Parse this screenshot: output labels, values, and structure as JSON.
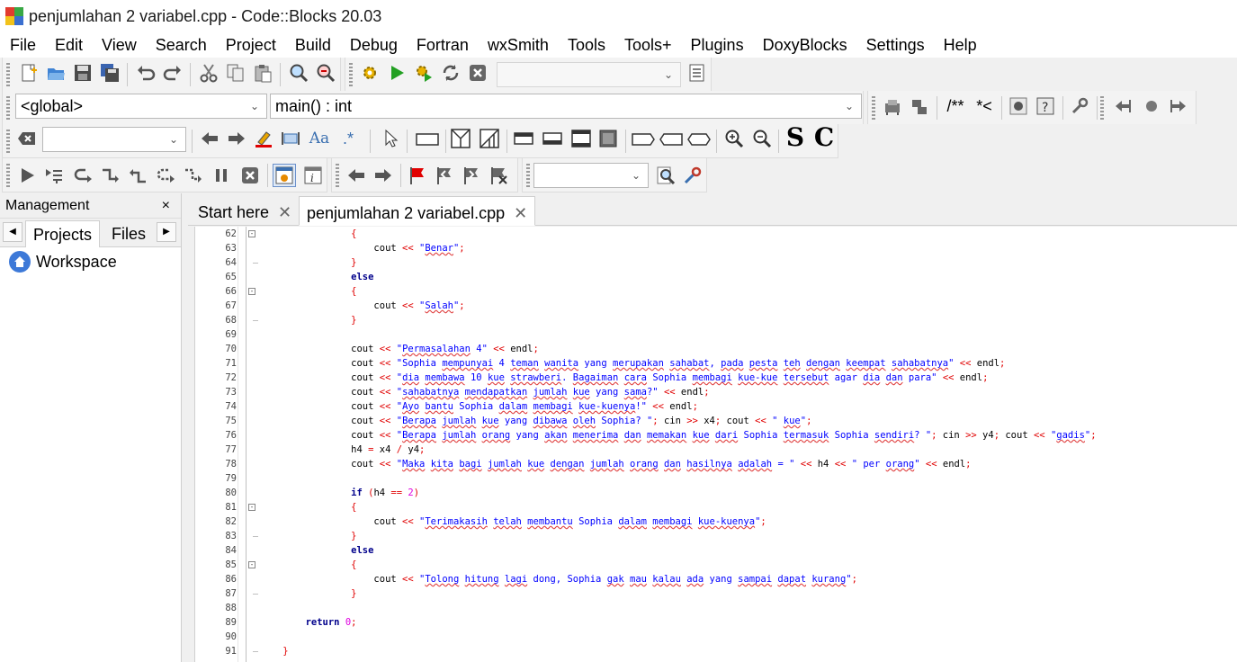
{
  "window": {
    "title": "penjumlahan 2 variabel.cpp - Code::Blocks 20.03"
  },
  "menu": [
    "File",
    "Edit",
    "View",
    "Search",
    "Project",
    "Build",
    "Debug",
    "Fortran",
    "wxSmith",
    "Tools",
    "Tools+",
    "Plugins",
    "DoxyBlocks",
    "Settings",
    "Help"
  ],
  "toolbar": {
    "scope_combo": "<global>",
    "function_combo": "main() : int",
    "doxy_comment": "/**",
    "doxy_inline": "*<",
    "bold_s": "S",
    "bold_c": "C"
  },
  "management": {
    "title": "Management",
    "close": "×",
    "tabs": [
      "Projects",
      "Files"
    ],
    "workspace": "Workspace"
  },
  "editor_tabs": [
    {
      "label": "Start here",
      "close": "✕"
    },
    {
      "label": "penjumlahan 2 variabel.cpp",
      "close": "✕"
    }
  ],
  "code_lines": [
    {
      "n": "62",
      "fold": "minus",
      "t": [
        [
          "op",
          "                {"
        ]
      ]
    },
    {
      "n": "63",
      "fold": "",
      "t": [
        [
          "id",
          "                    cout "
        ],
        [
          "op",
          "<<"
        ],
        [
          "id",
          " "
        ],
        [
          "str",
          "\""
        ],
        [
          "sq",
          "Benar"
        ],
        [
          "str",
          "\""
        ],
        [
          "op",
          ";"
        ]
      ]
    },
    {
      "n": "64",
      "fold": "end",
      "t": [
        [
          "op",
          "                }"
        ]
      ]
    },
    {
      "n": "65",
      "fold": "",
      "t": [
        [
          "kw",
          "                else"
        ]
      ]
    },
    {
      "n": "66",
      "fold": "minus",
      "t": [
        [
          "op",
          "                {"
        ]
      ]
    },
    {
      "n": "67",
      "fold": "",
      "t": [
        [
          "id",
          "                    cout "
        ],
        [
          "op",
          "<<"
        ],
        [
          "id",
          " "
        ],
        [
          "str",
          "\""
        ],
        [
          "sq",
          "Salah"
        ],
        [
          "str",
          "\""
        ],
        [
          "op",
          ";"
        ]
      ]
    },
    {
      "n": "68",
      "fold": "end",
      "t": [
        [
          "op",
          "                }"
        ]
      ]
    },
    {
      "n": "69",
      "fold": "",
      "t": []
    },
    {
      "n": "70",
      "fold": "",
      "t": [
        [
          "id",
          "                cout "
        ],
        [
          "op",
          "<<"
        ],
        [
          "id",
          " "
        ],
        [
          "str",
          "\""
        ],
        [
          "sq",
          "Permasalahan"
        ],
        [
          "str",
          " 4\""
        ],
        [
          "id",
          " "
        ],
        [
          "op",
          "<<"
        ],
        [
          "id",
          " endl"
        ],
        [
          "op",
          ";"
        ]
      ]
    },
    {
      "n": "71",
      "fold": "",
      "t": [
        [
          "id",
          "                cout "
        ],
        [
          "op",
          "<<"
        ],
        [
          "id",
          " "
        ],
        [
          "str",
          "\"Sophia "
        ],
        [
          "sq",
          "mempunyai"
        ],
        [
          "str",
          " 4 "
        ],
        [
          "sq",
          "teman"
        ],
        [
          "str",
          " "
        ],
        [
          "sq",
          "wanita"
        ],
        [
          "str",
          " yang "
        ],
        [
          "sq",
          "merupakan"
        ],
        [
          "str",
          " "
        ],
        [
          "sq",
          "sahabat"
        ],
        [
          "str",
          ", "
        ],
        [
          "sq",
          "pada"
        ],
        [
          "str",
          " "
        ],
        [
          "sq",
          "pesta"
        ],
        [
          "str",
          " "
        ],
        [
          "sq",
          "teh"
        ],
        [
          "str",
          " "
        ],
        [
          "sq",
          "dengan"
        ],
        [
          "str",
          " "
        ],
        [
          "sq",
          "keempat"
        ],
        [
          "str",
          " "
        ],
        [
          "sq",
          "sahabatnya"
        ],
        [
          "str",
          "\""
        ],
        [
          "id",
          " "
        ],
        [
          "op",
          "<<"
        ],
        [
          "id",
          " endl"
        ],
        [
          "op",
          ";"
        ]
      ]
    },
    {
      "n": "72",
      "fold": "",
      "t": [
        [
          "id",
          "                cout "
        ],
        [
          "op",
          "<<"
        ],
        [
          "id",
          " "
        ],
        [
          "str",
          "\""
        ],
        [
          "sq",
          "dia"
        ],
        [
          "str",
          " "
        ],
        [
          "sq",
          "membawa"
        ],
        [
          "str",
          " 10 "
        ],
        [
          "sq",
          "kue"
        ],
        [
          "str",
          " "
        ],
        [
          "sq",
          "strawberi"
        ],
        [
          "str",
          ". "
        ],
        [
          "sq",
          "Bagaiman"
        ],
        [
          "str",
          " "
        ],
        [
          "sq",
          "cara"
        ],
        [
          "str",
          " Sophia "
        ],
        [
          "sq",
          "membagi"
        ],
        [
          "str",
          " "
        ],
        [
          "sq",
          "kue-kue"
        ],
        [
          "str",
          " "
        ],
        [
          "sq",
          "tersebut"
        ],
        [
          "str",
          " agar "
        ],
        [
          "sq",
          "dia"
        ],
        [
          "str",
          " "
        ],
        [
          "sq",
          "dan"
        ],
        [
          "str",
          " para\""
        ],
        [
          "id",
          " "
        ],
        [
          "op",
          "<<"
        ],
        [
          "id",
          " endl"
        ],
        [
          "op",
          ";"
        ]
      ]
    },
    {
      "n": "73",
      "fold": "",
      "t": [
        [
          "id",
          "                cout "
        ],
        [
          "op",
          "<<"
        ],
        [
          "id",
          " "
        ],
        [
          "str",
          "\""
        ],
        [
          "sq",
          "sahabatnya"
        ],
        [
          "str",
          " "
        ],
        [
          "sq",
          "mendapatkan"
        ],
        [
          "str",
          " "
        ],
        [
          "sq",
          "jumlah"
        ],
        [
          "str",
          " "
        ],
        [
          "sq",
          "kue"
        ],
        [
          "str",
          " yang "
        ],
        [
          "sq",
          "sama"
        ],
        [
          "str",
          "?\""
        ],
        [
          "id",
          " "
        ],
        [
          "op",
          "<<"
        ],
        [
          "id",
          " endl"
        ],
        [
          "op",
          ";"
        ]
      ]
    },
    {
      "n": "74",
      "fold": "",
      "t": [
        [
          "id",
          "                cout "
        ],
        [
          "op",
          "<<"
        ],
        [
          "id",
          " "
        ],
        [
          "str",
          "\""
        ],
        [
          "sq",
          "Ayo"
        ],
        [
          "str",
          " "
        ],
        [
          "sq",
          "bantu"
        ],
        [
          "str",
          " Sophia "
        ],
        [
          "sq",
          "dalam"
        ],
        [
          "str",
          " "
        ],
        [
          "sq",
          "membagi"
        ],
        [
          "str",
          " "
        ],
        [
          "sq",
          "kue-kuenya"
        ],
        [
          "str",
          "!\""
        ],
        [
          "id",
          " "
        ],
        [
          "op",
          "<<"
        ],
        [
          "id",
          " endl"
        ],
        [
          "op",
          ";"
        ]
      ]
    },
    {
      "n": "75",
      "fold": "",
      "t": [
        [
          "id",
          "                cout "
        ],
        [
          "op",
          "<<"
        ],
        [
          "id",
          " "
        ],
        [
          "str",
          "\""
        ],
        [
          "sq",
          "Berapa"
        ],
        [
          "str",
          " "
        ],
        [
          "sq",
          "jumlah"
        ],
        [
          "str",
          " "
        ],
        [
          "sq",
          "kue"
        ],
        [
          "str",
          " yang "
        ],
        [
          "sq",
          "dibawa"
        ],
        [
          "str",
          " "
        ],
        [
          "sq",
          "oleh"
        ],
        [
          "str",
          " Sophia? \""
        ],
        [
          "op",
          ";"
        ],
        [
          "id",
          " cin "
        ],
        [
          "op",
          ">>"
        ],
        [
          "id",
          " x4"
        ],
        [
          "op",
          ";"
        ],
        [
          "id",
          " cout "
        ],
        [
          "op",
          "<<"
        ],
        [
          "id",
          " "
        ],
        [
          "str",
          "\" "
        ],
        [
          "sq",
          "kue"
        ],
        [
          "str",
          "\""
        ],
        [
          "op",
          ";"
        ]
      ]
    },
    {
      "n": "76",
      "fold": "",
      "t": [
        [
          "id",
          "                cout "
        ],
        [
          "op",
          "<<"
        ],
        [
          "id",
          " "
        ],
        [
          "str",
          "\""
        ],
        [
          "sq",
          "Berapa"
        ],
        [
          "str",
          " "
        ],
        [
          "sq",
          "jumlah"
        ],
        [
          "str",
          " "
        ],
        [
          "sq",
          "orang"
        ],
        [
          "str",
          " yang "
        ],
        [
          "sq",
          "akan"
        ],
        [
          "str",
          " "
        ],
        [
          "sq",
          "menerima"
        ],
        [
          "str",
          " "
        ],
        [
          "sq",
          "dan"
        ],
        [
          "str",
          " "
        ],
        [
          "sq",
          "memakan"
        ],
        [
          "str",
          " "
        ],
        [
          "sq",
          "kue"
        ],
        [
          "str",
          " "
        ],
        [
          "sq",
          "dari"
        ],
        [
          "str",
          " Sophia "
        ],
        [
          "sq",
          "termasuk"
        ],
        [
          "str",
          " Sophia "
        ],
        [
          "sq",
          "sendiri"
        ],
        [
          "str",
          "? \""
        ],
        [
          "op",
          ";"
        ],
        [
          "id",
          " cin "
        ],
        [
          "op",
          ">>"
        ],
        [
          "id",
          " y4"
        ],
        [
          "op",
          ";"
        ],
        [
          "id",
          " cout "
        ],
        [
          "op",
          "<<"
        ],
        [
          "id",
          " "
        ],
        [
          "str",
          "\""
        ],
        [
          "sq",
          "gadis"
        ],
        [
          "str",
          "\""
        ],
        [
          "op",
          ";"
        ]
      ]
    },
    {
      "n": "77",
      "fold": "",
      "t": [
        [
          "id",
          "                h4 "
        ],
        [
          "op",
          "="
        ],
        [
          "id",
          " x4 "
        ],
        [
          "op",
          "/"
        ],
        [
          "id",
          " y4"
        ],
        [
          "op",
          ";"
        ]
      ]
    },
    {
      "n": "78",
      "fold": "",
      "t": [
        [
          "id",
          "                cout "
        ],
        [
          "op",
          "<<"
        ],
        [
          "id",
          " "
        ],
        [
          "str",
          "\""
        ],
        [
          "sq",
          "Maka"
        ],
        [
          "str",
          " "
        ],
        [
          "sq",
          "kita"
        ],
        [
          "str",
          " "
        ],
        [
          "sq",
          "bagi"
        ],
        [
          "str",
          " "
        ],
        [
          "sq",
          "jumlah"
        ],
        [
          "str",
          " "
        ],
        [
          "sq",
          "kue"
        ],
        [
          "str",
          " "
        ],
        [
          "sq",
          "dengan"
        ],
        [
          "str",
          " "
        ],
        [
          "sq",
          "jumlah"
        ],
        [
          "str",
          " "
        ],
        [
          "sq",
          "orang"
        ],
        [
          "str",
          " "
        ],
        [
          "sq",
          "dan"
        ],
        [
          "str",
          " "
        ],
        [
          "sq",
          "hasilnya"
        ],
        [
          "str",
          " "
        ],
        [
          "sq",
          "adalah"
        ],
        [
          "str",
          " = \""
        ],
        [
          "id",
          " "
        ],
        [
          "op",
          "<<"
        ],
        [
          "id",
          " h4 "
        ],
        [
          "op",
          "<<"
        ],
        [
          "id",
          " "
        ],
        [
          "str",
          "\" per "
        ],
        [
          "sq",
          "orang"
        ],
        [
          "str",
          "\""
        ],
        [
          "id",
          " "
        ],
        [
          "op",
          "<<"
        ],
        [
          "id",
          " endl"
        ],
        [
          "op",
          ";"
        ]
      ]
    },
    {
      "n": "79",
      "fold": "",
      "t": []
    },
    {
      "n": "80",
      "fold": "",
      "t": [
        [
          "kw",
          "                if"
        ],
        [
          "id",
          " "
        ],
        [
          "op",
          "("
        ],
        [
          "id",
          "h4 "
        ],
        [
          "op",
          "=="
        ],
        [
          "id",
          " "
        ],
        [
          "num",
          "2"
        ],
        [
          "op",
          ")"
        ]
      ]
    },
    {
      "n": "81",
      "fold": "minus",
      "t": [
        [
          "op",
          "                {"
        ]
      ]
    },
    {
      "n": "82",
      "fold": "",
      "t": [
        [
          "id",
          "                    cout "
        ],
        [
          "op",
          "<<"
        ],
        [
          "id",
          " "
        ],
        [
          "str",
          "\""
        ],
        [
          "sq",
          "Terimakasih"
        ],
        [
          "str",
          " "
        ],
        [
          "sq",
          "telah"
        ],
        [
          "str",
          " "
        ],
        [
          "sq",
          "membantu"
        ],
        [
          "str",
          " Sophia "
        ],
        [
          "sq",
          "dalam"
        ],
        [
          "str",
          " "
        ],
        [
          "sq",
          "membagi"
        ],
        [
          "str",
          " "
        ],
        [
          "sq",
          "kue-kuenya"
        ],
        [
          "str",
          "\""
        ],
        [
          "op",
          ";"
        ]
      ]
    },
    {
      "n": "83",
      "fold": "end",
      "t": [
        [
          "op",
          "                }"
        ]
      ]
    },
    {
      "n": "84",
      "fold": "",
      "t": [
        [
          "kw",
          "                else"
        ]
      ]
    },
    {
      "n": "85",
      "fold": "minus",
      "t": [
        [
          "op",
          "                {"
        ]
      ]
    },
    {
      "n": "86",
      "fold": "",
      "t": [
        [
          "id",
          "                    cout "
        ],
        [
          "op",
          "<<"
        ],
        [
          "id",
          " "
        ],
        [
          "str",
          "\""
        ],
        [
          "sq",
          "Tolong"
        ],
        [
          "str",
          " "
        ],
        [
          "sq",
          "hitung"
        ],
        [
          "str",
          " "
        ],
        [
          "sq",
          "lagi"
        ],
        [
          "str",
          " dong, Sophia "
        ],
        [
          "sq",
          "gak"
        ],
        [
          "str",
          " "
        ],
        [
          "sq",
          "mau"
        ],
        [
          "str",
          " "
        ],
        [
          "sq",
          "kalau"
        ],
        [
          "str",
          " "
        ],
        [
          "sq",
          "ada"
        ],
        [
          "str",
          " yang "
        ],
        [
          "sq",
          "sampai"
        ],
        [
          "str",
          " "
        ],
        [
          "sq",
          "dapat"
        ],
        [
          "str",
          " "
        ],
        [
          "sq",
          "kurang"
        ],
        [
          "str",
          "\""
        ],
        [
          "op",
          ";"
        ]
      ]
    },
    {
      "n": "87",
      "fold": "end",
      "t": [
        [
          "op",
          "                }"
        ]
      ]
    },
    {
      "n": "88",
      "fold": "",
      "t": []
    },
    {
      "n": "89",
      "fold": "",
      "t": [
        [
          "kw",
          "        return"
        ],
        [
          "id",
          " "
        ],
        [
          "num",
          "0"
        ],
        [
          "op",
          ";"
        ]
      ]
    },
    {
      "n": "90",
      "fold": "",
      "t": []
    },
    {
      "n": "91",
      "fold": "end",
      "t": [
        [
          "op",
          "    }"
        ]
      ]
    }
  ]
}
